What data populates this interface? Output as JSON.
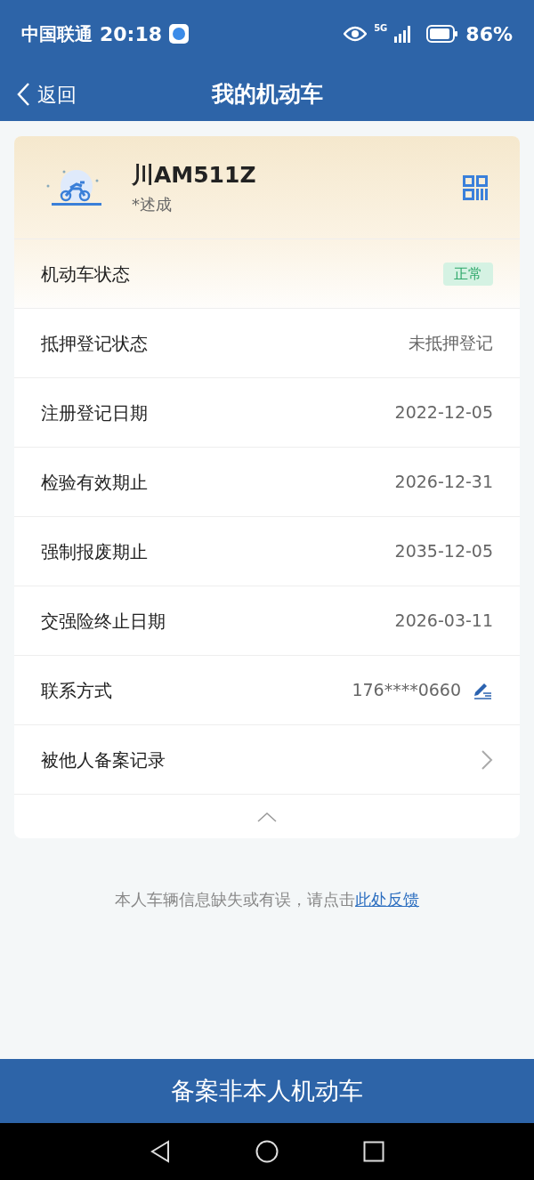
{
  "status_bar": {
    "carrier": "中国联通",
    "time": "20:18",
    "network": "5G",
    "battery": "86%"
  },
  "nav": {
    "back": "返回",
    "title": "我的机动车"
  },
  "vehicle": {
    "plate": "川AM511Z",
    "owner": "*述成"
  },
  "rows": [
    {
      "kind": "badge",
      "label": "机动车状态",
      "value": "正常"
    },
    {
      "kind": "text",
      "label": "抵押登记状态",
      "value": "未抵押登记"
    },
    {
      "kind": "text",
      "label": "注册登记日期",
      "value": "2022-12-05"
    },
    {
      "kind": "text",
      "label": "检验有效期止",
      "value": "2026-12-31"
    },
    {
      "kind": "text",
      "label": "强制报废期止",
      "value": "2035-12-05"
    },
    {
      "kind": "text",
      "label": "交强险终止日期",
      "value": "2026-03-11"
    },
    {
      "kind": "edit",
      "label": "联系方式",
      "value": "176****0660"
    },
    {
      "kind": "link",
      "label": "被他人备案记录"
    }
  ],
  "expanded": true,
  "feedback": {
    "text": "本人车辆信息缺失或有误，请点击",
    "link": "此处反馈"
  },
  "bottom_button": "备案非本人机动车"
}
